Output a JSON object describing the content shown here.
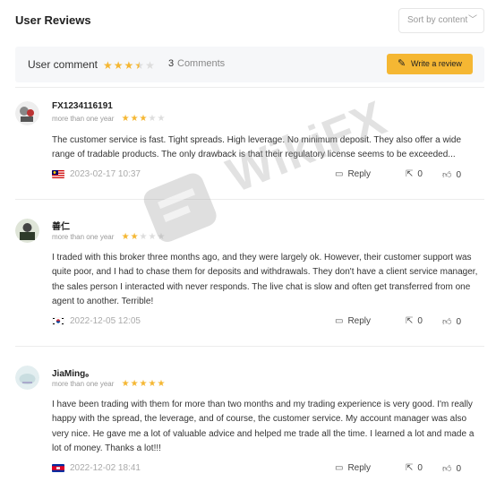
{
  "header": {
    "title": "User Reviews",
    "sort_label": "Sort by content"
  },
  "summary": {
    "label": "User comment",
    "rating": 3.5,
    "count": "3",
    "count_word": "Comments",
    "write_label": "Write a review"
  },
  "reviews": [
    {
      "name": "FX1234116191",
      "tenure": "more than one year",
      "rating": 3,
      "text": "The customer service is fast. Tight spreads. High leverage. No minimum deposit. They also offer a wide range of tradable products. The only drawback is that their regulatory license seems to be exceeded...",
      "date": "2023-02-17 10:37",
      "reply": "Reply",
      "shares": "0",
      "likes": "0"
    },
    {
      "name": "善仁",
      "tenure": "more than one year",
      "rating": 2,
      "text": "I traded with this broker three months ago, and they were largely ok. However, their customer support was quite poor, and I had to chase them for deposits and withdrawals. They don't have a client service manager, the sales person I interacted with never responds. The live chat is slow and often get transferred from one agent to another. Terrible!",
      "date": "2022-12-05 12:05",
      "reply": "Reply",
      "shares": "0",
      "likes": "0"
    },
    {
      "name": "JiaMing。",
      "tenure": "more than one year",
      "rating": 5,
      "text": "I have been trading with them for more than two months and my trading experience is very good. I'm really happy with the spread, the leverage, and of course, the customer service. My account manager was also very nice. He gave me a lot of valuable advice and helped me trade all the time. I learned a lot and made a lot of money. Thanks a lot!!!",
      "date": "2022-12-02 18:41",
      "reply": "Reply",
      "shares": "0",
      "likes": "0"
    }
  ],
  "watermark": {
    "text": "WikiFX"
  },
  "colors": {
    "accent": "#f5b733",
    "summary_bg": "#f6f7f9"
  }
}
